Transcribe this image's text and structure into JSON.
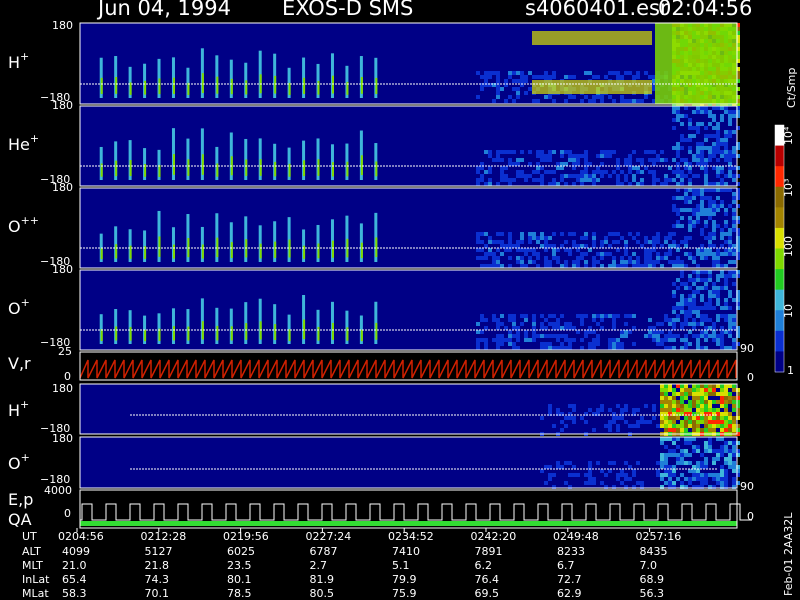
{
  "header": {
    "date": "Jun 04, 1994",
    "instrument": "EXOS-D SMS",
    "file": "s4060401.esr",
    "time": "02:04:56"
  },
  "panels": [
    {
      "species": "H",
      "charge": "+",
      "tick_top": "180",
      "tick_bottom": "−180"
    },
    {
      "species": "He",
      "charge": "+",
      "tick_top": "180",
      "tick_bottom": "−180"
    },
    {
      "species": "O",
      "charge": "++",
      "tick_top": "180",
      "tick_bottom": "−180"
    },
    {
      "species": "O",
      "charge": "+",
      "tick_top": "180",
      "tick_bottom": "−180"
    }
  ],
  "vr_panel": {
    "label": "V,r",
    "tick_top": "25",
    "tick_bottom": "0",
    "right_tick_top": "90",
    "right_tick_bottom": "0"
  },
  "lower_panels": [
    {
      "species": "H",
      "charge": "+",
      "tick_top": "180",
      "tick_bottom": "−180"
    },
    {
      "species": "O",
      "charge": "+",
      "tick_top": "180",
      "tick_bottom": "−180",
      "right_tick": "90"
    }
  ],
  "ep_panel": {
    "label1": "E,p",
    "label2": "QA",
    "tick_top": "4000",
    "tick_bottom": "0",
    "right_tick": "0"
  },
  "colorbar": {
    "unit": "Ct/Smp",
    "labels": [
      "1",
      "10",
      "100",
      "10³",
      "10⁴"
    ],
    "colors": [
      "#000086",
      "#0a2fd0",
      "#1f7fd8",
      "#3fb6da",
      "#22cc22",
      "#7fd900",
      "#d9e000",
      "#a38400",
      "#8a6a00",
      "#ff2800",
      "#b80000",
      "#ffffff"
    ]
  },
  "footer_code": "Feb-01 2AA32L",
  "chart_data": {
    "type": "heatmap",
    "title": "Jun 04, 1994   EXOS-D SMS",
    "x_axis": "UT",
    "ut_ticks": [
      "0204:56",
      "0212:28",
      "0219:56",
      "0227:24",
      "0234:52",
      "0242:20",
      "0249:48",
      "0257:16"
    ],
    "ephemeris": [
      {
        "name": "ALT",
        "values": [
          "4099",
          "5127",
          "6025",
          "6787",
          "7410",
          "7891",
          "8233",
          "8435"
        ]
      },
      {
        "name": "MLT",
        "values": [
          "21.0",
          "21.8",
          "23.5",
          "2.7",
          "5.1",
          "6.2",
          "6.7",
          "7.0"
        ]
      },
      {
        "name": "InLat",
        "values": [
          "65.4",
          "74.3",
          "80.1",
          "81.9",
          "79.9",
          "76.4",
          "72.7",
          "68.9"
        ]
      },
      {
        "name": "MLat",
        "values": [
          "58.3",
          "70.1",
          "78.5",
          "80.5",
          "75.9",
          "69.5",
          "62.9",
          "56.3"
        ]
      }
    ],
    "y_range_pitch_angle": [
      -180,
      180
    ],
    "color_scale": "log",
    "color_range_counts": [
      1,
      10000
    ]
  }
}
